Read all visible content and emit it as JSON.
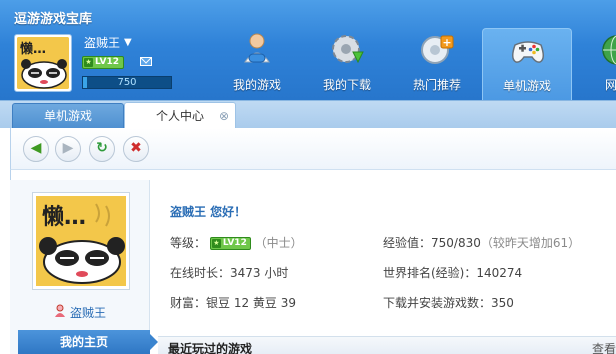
{
  "app": {
    "title": "逗游游戏宝库"
  },
  "user": {
    "name": "盗贼王",
    "level": "LV12",
    "exp_value": "750",
    "exp_fraction": 0.05
  },
  "nav": [
    {
      "label": "我的游戏",
      "icon": "person-controller-icon"
    },
    {
      "label": "我的下载",
      "icon": "gear-download-icon"
    },
    {
      "label": "热门推荐",
      "icon": "recommend-plus-icon"
    },
    {
      "label": "单机游戏",
      "icon": "gamepad-icon",
      "active": true
    },
    {
      "label": "网络",
      "icon": "globe-icon"
    }
  ],
  "tabs": {
    "games": "单机游戏",
    "personal": "个人中心",
    "close": "⊗"
  },
  "toolbar": {
    "back": "◀",
    "forward": "▶",
    "refresh": "↻",
    "stop": "✖"
  },
  "profile": {
    "username": "盗贼王",
    "my_home": "我的主页",
    "greeting": "盗贼王  您好！",
    "level_label": "等级：",
    "level_badge": "LV12",
    "level_rank": "（中士）",
    "exp_label": "经验值：750/830",
    "exp_extra": "（较昨天增加61）",
    "online_time": "在线时长：3473 小时",
    "world_rank": "世界排名(经验)：140274",
    "wealth": "财富：银豆 12  黄豆 39",
    "downloads": "下载并安装游戏数：350"
  },
  "recent": {
    "title": "最近玩过的游戏",
    "more": "查看"
  },
  "colors": {
    "header_blue": "#2f82d8",
    "level_green": "#6fc74a",
    "link_blue": "#2a6db5"
  }
}
